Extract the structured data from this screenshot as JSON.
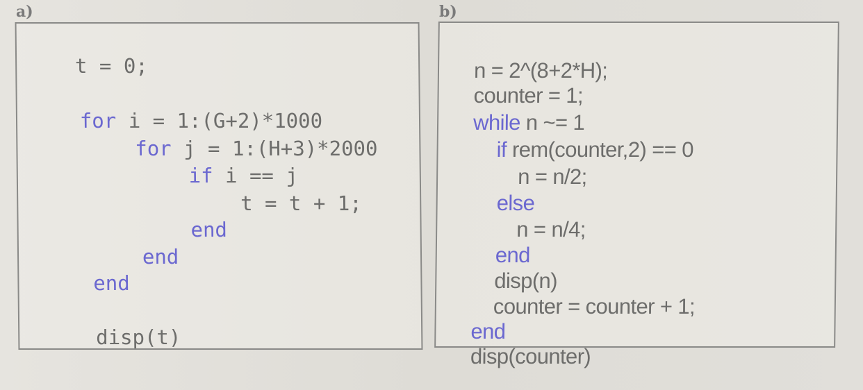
{
  "colors": {
    "keyword": "#6b68d0",
    "text": "#6d6d6b",
    "border": "#8a8a88",
    "background": "#e3e1dc"
  },
  "panel_a": {
    "label": "a)",
    "lines": [
      {
        "keyword": "",
        "text": "t = 0;"
      },
      {
        "keyword": "for",
        "text": " i = 1:(G+2)*1000"
      },
      {
        "keyword": "for",
        "text": " j = 1:(H+3)*2000"
      },
      {
        "keyword": "if",
        "text": " i == j"
      },
      {
        "keyword": "",
        "text": "t = t + 1;"
      },
      {
        "keyword": "end",
        "text": ""
      },
      {
        "keyword": "end",
        "text": ""
      },
      {
        "keyword": "end",
        "text": ""
      },
      {
        "keyword": "",
        "text": "disp(t)"
      }
    ]
  },
  "panel_b": {
    "label": "b)",
    "lines": [
      {
        "keyword": "",
        "text": "n = 2^(8+2*H);"
      },
      {
        "keyword": "",
        "text": "counter = 1;"
      },
      {
        "keyword": "while",
        "text": " n ~= 1"
      },
      {
        "keyword": "if",
        "text": " rem(counter,2) == 0"
      },
      {
        "keyword": "",
        "text": "n = n/2;"
      },
      {
        "keyword": "else",
        "text": ""
      },
      {
        "keyword": "",
        "text": "n = n/4;"
      },
      {
        "keyword": "end",
        "text": ""
      },
      {
        "keyword": "",
        "text": "disp(n)"
      },
      {
        "keyword": "",
        "text": "counter = counter + 1;"
      },
      {
        "keyword": "end",
        "text": ""
      },
      {
        "keyword": "",
        "text": "disp(counter)"
      }
    ]
  }
}
